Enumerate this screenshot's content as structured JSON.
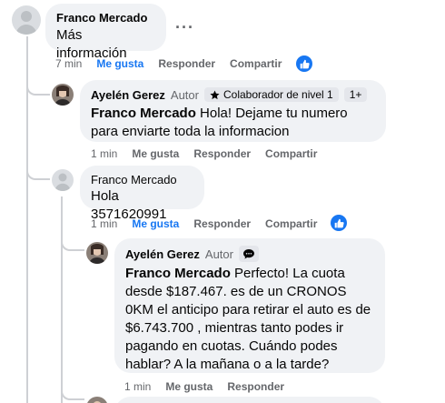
{
  "comments": [
    {
      "author": "Franco Mercado",
      "text": "Más información",
      "time": "7 min",
      "like": "Me gusta",
      "reply": "Responder",
      "share": "Compartir",
      "more": "···"
    },
    {
      "author": "Ayelén Gerez",
      "role": "Autor",
      "badge": "Colaborador de nivel 1",
      "badge_extra": "1+",
      "mention": "Franco Mercado",
      "text": " Hola! Dejame tu numero para enviarte toda la informacion",
      "time": "1 min",
      "like": "Me gusta",
      "reply": "Responder",
      "share": "Compartir"
    },
    {
      "author": "Franco Mercado",
      "text": "Hola 3571620991",
      "time": "1 min",
      "like": "Me gusta",
      "reply": "Responder",
      "share": "Compartir"
    },
    {
      "author": "Ayelén Gerez",
      "role": "Autor",
      "mention": "Franco Mercado",
      "text": " Perfecto! La cuota desde $187.467. es de un CRONOS 0KM el anticipo para retirar el auto es de $6.743.700 , mientras tanto podes ir pagando en cuotas. Cuándo podes hablar? A la mañana o a la tarde?",
      "time": "1 min",
      "like": "Me gusta",
      "reply": "Responder"
    }
  ],
  "colors": {
    "accent": "#1877f2",
    "bubble": "#f0f2f5",
    "muted": "#65676b"
  },
  "icons": [
    "default-avatar-icon",
    "star-icon",
    "chat-bubble-icon",
    "thumbs-up-icon"
  ]
}
